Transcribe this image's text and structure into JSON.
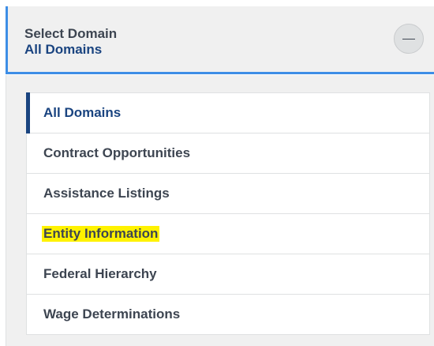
{
  "header": {
    "label": "Select Domain",
    "selected_value": "All Domains",
    "collapse_icon": "minus-icon"
  },
  "domains": {
    "items": [
      {
        "label": "All Domains",
        "state": "selected"
      },
      {
        "label": "Contract Opportunities",
        "state": "default"
      },
      {
        "label": "Assistance Listings",
        "state": "default"
      },
      {
        "label": "Entity Information",
        "state": "highlighted"
      },
      {
        "label": "Federal Hierarchy",
        "state": "default"
      },
      {
        "label": "Wage Determinations",
        "state": "default"
      }
    ]
  },
  "colors": {
    "accent_blue": "#3d8ee6",
    "selected_navy": "#1a4480",
    "highlight_yellow": "#fff200",
    "panel_bg": "#f0f0f0"
  }
}
